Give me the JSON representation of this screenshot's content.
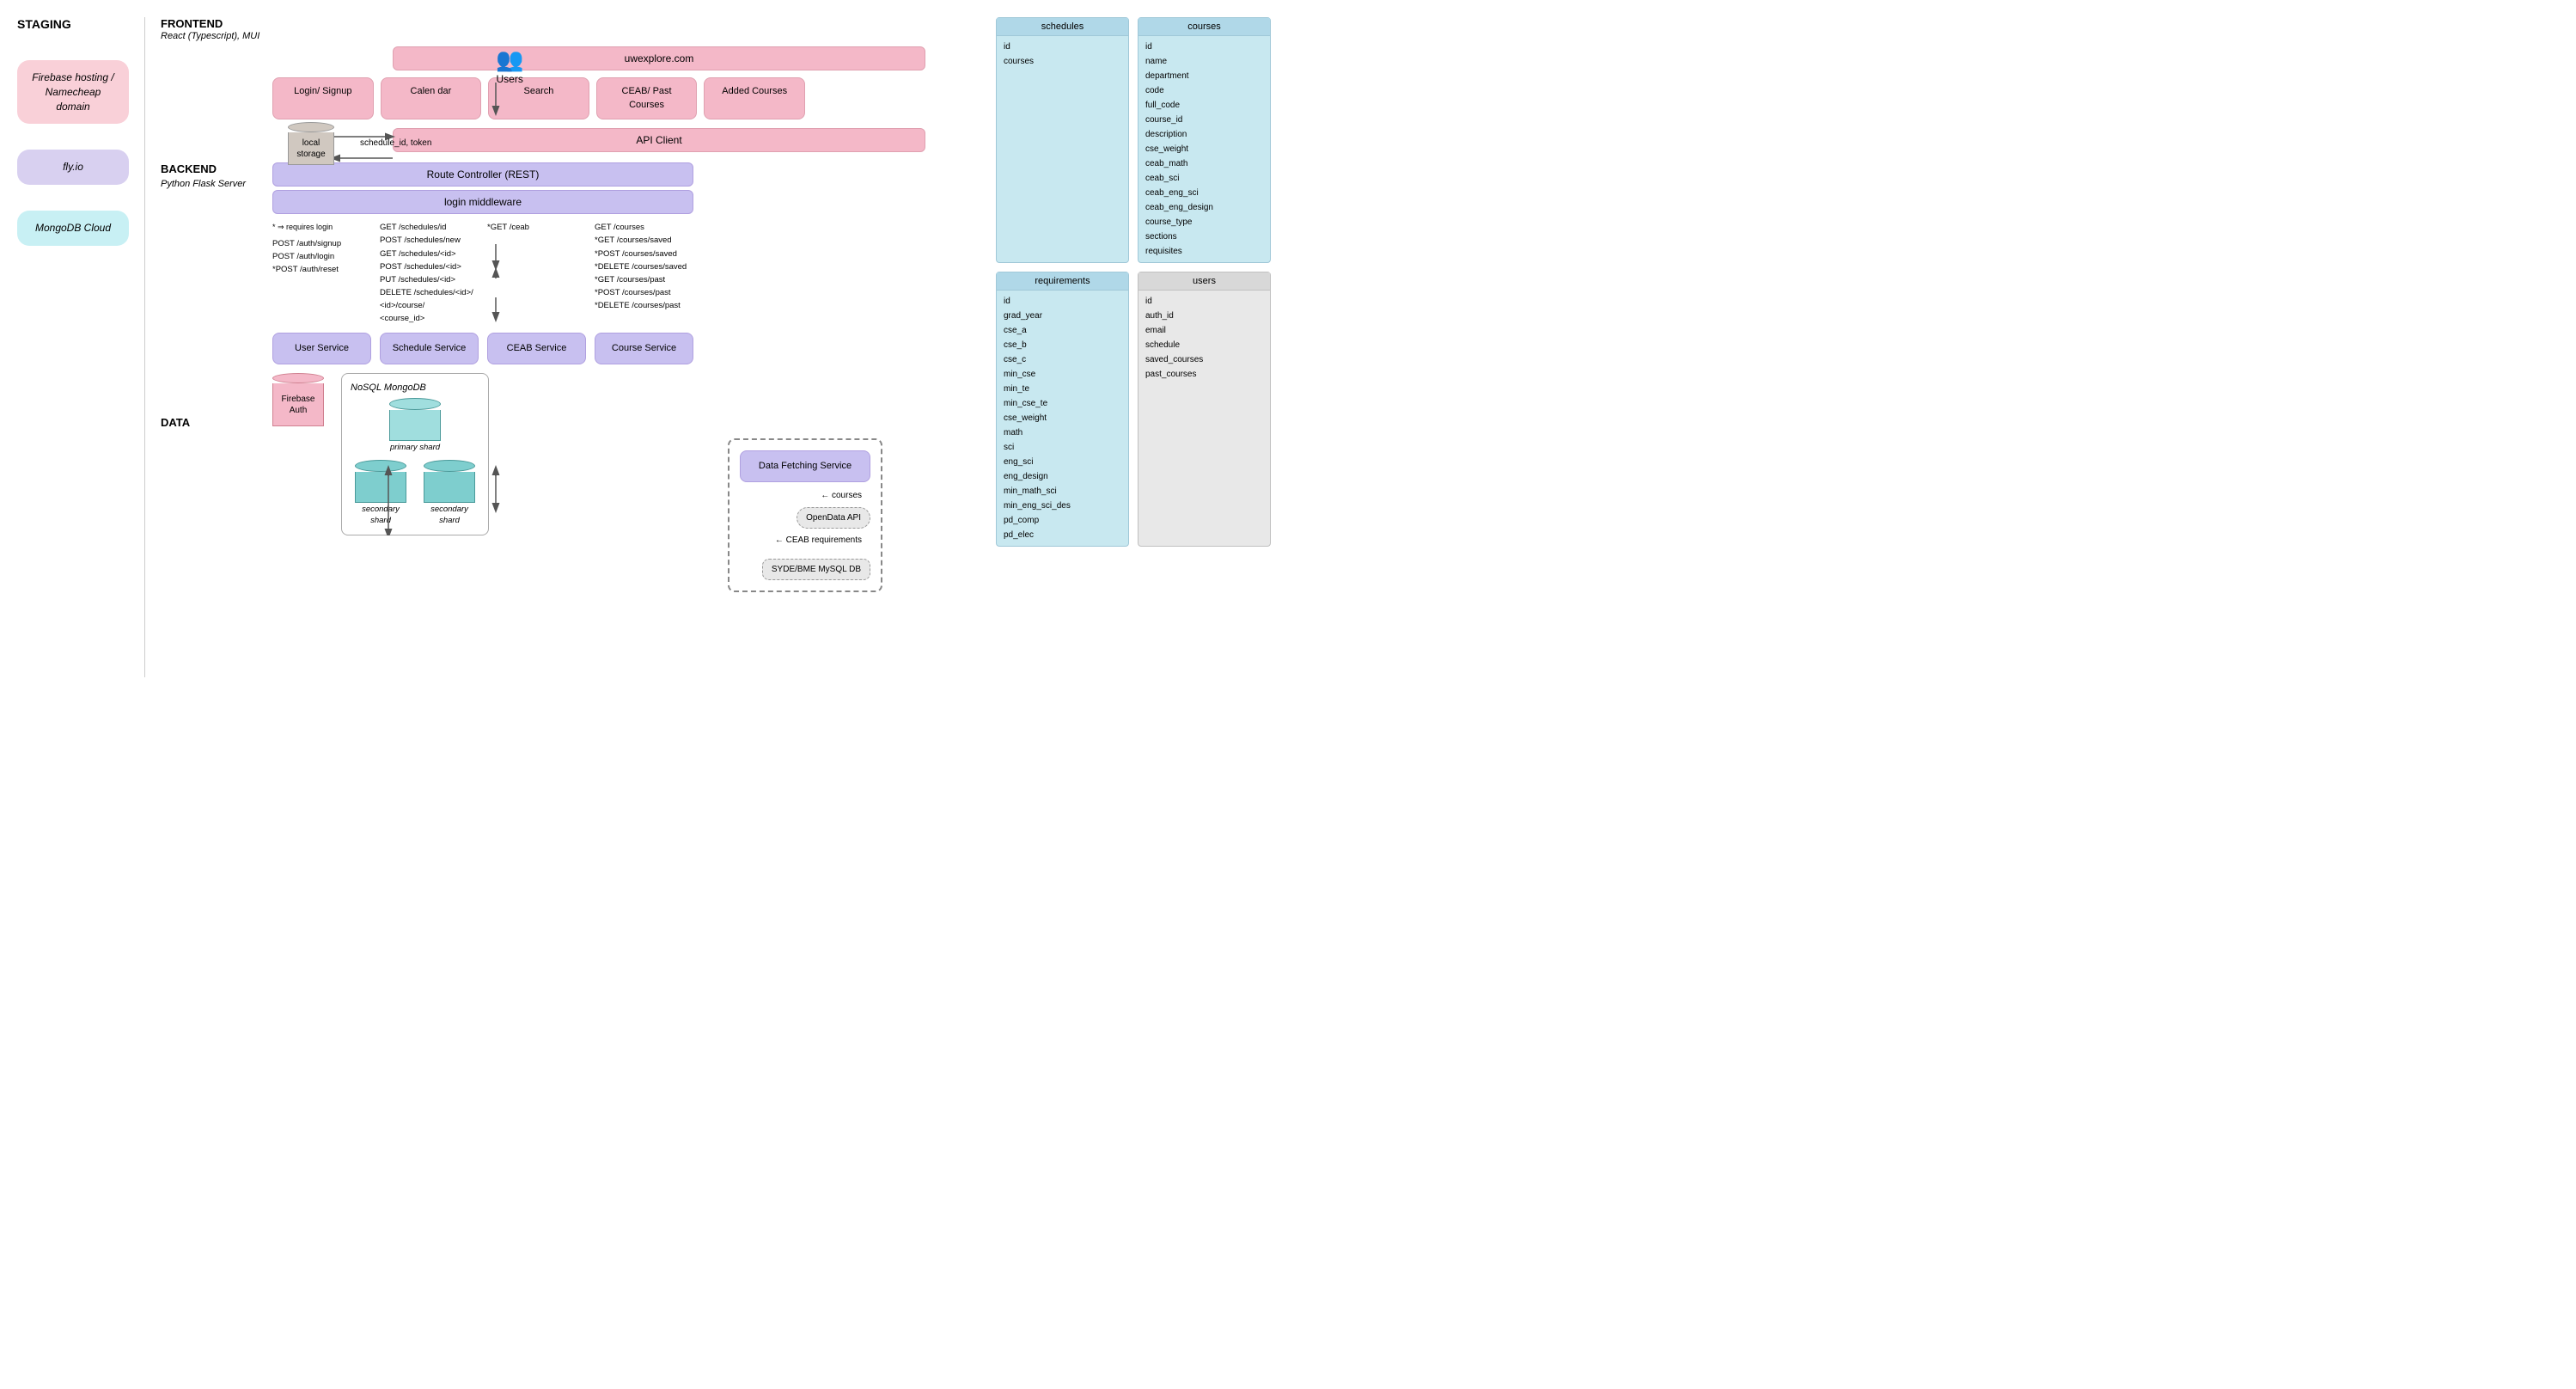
{
  "staging": {
    "title": "STAGING"
  },
  "sidebar": {
    "firebase": "Firebase hosting / Namecheap domain",
    "flyio": "fly.io",
    "mongodb": "MongoDB Cloud"
  },
  "frontend": {
    "title": "FRONTEND",
    "subtitle": "React (Typescript), MUI",
    "url": "uwexplore.com",
    "local_storage": "local storage",
    "schedule_token": "schedule_id, token",
    "nav_buttons": [
      "Login/ Signup",
      "Calen dar",
      "Search",
      "CEAB/ Past Courses",
      "Added Courses"
    ],
    "api_client": "API Client"
  },
  "backend": {
    "title": "BACKEND",
    "subtitle": "Python Flask Server",
    "route_controller": "Route Controller (REST)",
    "login_middleware": "login middleware",
    "requires_note": "* ⇒ requires login",
    "routes": {
      "col1": "POST /auth/signup\nPOST /auth/login\n*POST /auth/reset",
      "col2": "GET /schedules/id\nPOST /schedules/new\nGET /schedules/<id>\nPOST /schedules/<id>\nPUT /schedules/<id>\nDELETE /schedules/<id>/<course_id>",
      "col3": "*GET /ceab",
      "col4": "GET /courses\n*GET /courses/saved\n*POST /courses/saved\n*DELETE /courses/saved\n*GET /courses/past\n*POST /courses/past\n*DELETE /courses/past"
    }
  },
  "services": {
    "user": "User Service",
    "schedule": "Schedule Service",
    "ceab": "CEAB Service",
    "course": "Course Service"
  },
  "data_section": {
    "title": "DATA",
    "firebase_auth": "Firebase Auth",
    "nosql_mongodb": "NoSQL MongoDB",
    "primary_shard": "primary shard",
    "secondary_shard1": "secondary shard",
    "secondary_shard2": "secondary shard"
  },
  "data_fetching": {
    "title": "Data Fetching Service",
    "opendata_api": "OpenData API",
    "mysql_db": "SYDE/BME MySQL DB",
    "courses_label": "courses",
    "ceab_req_label": "CEAB requirements"
  },
  "db_tables": {
    "schedules": {
      "header": "schedules",
      "fields": [
        "id",
        "courses"
      ]
    },
    "courses": {
      "header": "courses",
      "fields": [
        "id",
        "name",
        "department",
        "code",
        "full_code",
        "course_id",
        "description",
        "cse_weight",
        "ceab_math",
        "ceab_sci",
        "ceab_eng_sci",
        "ceab_eng_design",
        "course_type",
        "sections",
        "requisites"
      ]
    },
    "requirements": {
      "header": "requirements",
      "fields": [
        "id",
        "grad_year",
        "cse_a",
        "cse_b",
        "cse_c",
        "min_cse",
        "min_te",
        "min_cse_te",
        "cse_weight",
        "math",
        "sci",
        "eng_sci",
        "eng_design",
        "min_math_sci",
        "min_eng_sci_des",
        "pd_comp",
        "pd_elec"
      ]
    },
    "users": {
      "header": "users",
      "fields": [
        "id",
        "auth_id",
        "email",
        "schedule",
        "saved_courses",
        "past_courses"
      ]
    }
  },
  "users_label": "Users"
}
